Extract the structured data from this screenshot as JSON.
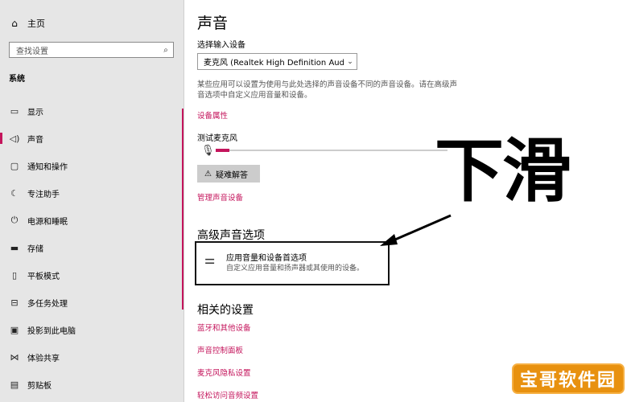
{
  "sidebar": {
    "home": {
      "label": "主页",
      "icon": "home-icon"
    },
    "search": {
      "placeholder": "查找设置",
      "icon": "search-icon"
    },
    "section_label": "系统",
    "items": [
      {
        "label": "显示",
        "icon": "display-icon"
      },
      {
        "label": "声音",
        "icon": "speaker-icon",
        "active": true
      },
      {
        "label": "通知和操作",
        "icon": "notification-icon"
      },
      {
        "label": "专注助手",
        "icon": "moon-icon"
      },
      {
        "label": "电源和睡眠",
        "icon": "power-icon"
      },
      {
        "label": "存储",
        "icon": "storage-icon"
      },
      {
        "label": "平板模式",
        "icon": "tablet-icon"
      },
      {
        "label": "多任务处理",
        "icon": "multitask-icon"
      },
      {
        "label": "投影到此电脑",
        "icon": "project-icon"
      },
      {
        "label": "体验共享",
        "icon": "share-icon"
      },
      {
        "label": "剪贴板",
        "icon": "clipboard-icon"
      }
    ]
  },
  "main": {
    "title": "声音",
    "input_device_label": "选择输入设备",
    "input_device_value": "麦克风 (Realtek High Definition Audi...",
    "description": "某些应用可以设置为使用与此处选择的声音设备不同的声音设备。请在高级声音选项中自定义应用音量和设备。",
    "device_properties_link": "设备属性",
    "test_mic_label": "测试麦克风",
    "mic_level": 0.06,
    "troubleshoot_button": "疑难解答",
    "manage_devices_link": "管理声音设备",
    "advanced_title": "高级声音选项",
    "advanced_option": {
      "title": "应用音量和设备首选项",
      "subtitle": "自定义应用音量和扬声器或其使用的设备。",
      "icon": "sliders-icon"
    },
    "related_title": "相关的设置",
    "related_links": [
      "蓝牙和其他设备",
      "声音控制面板",
      "麦克风隐私设置",
      "轻松访问音频设置"
    ]
  },
  "overlay": {
    "text": "下滑"
  },
  "watermark": {
    "text": "宝哥软件园"
  },
  "colors": {
    "accent": "#c4155c",
    "sidebar_bg": "#e6e6e6",
    "watermark": "#e8910f"
  }
}
